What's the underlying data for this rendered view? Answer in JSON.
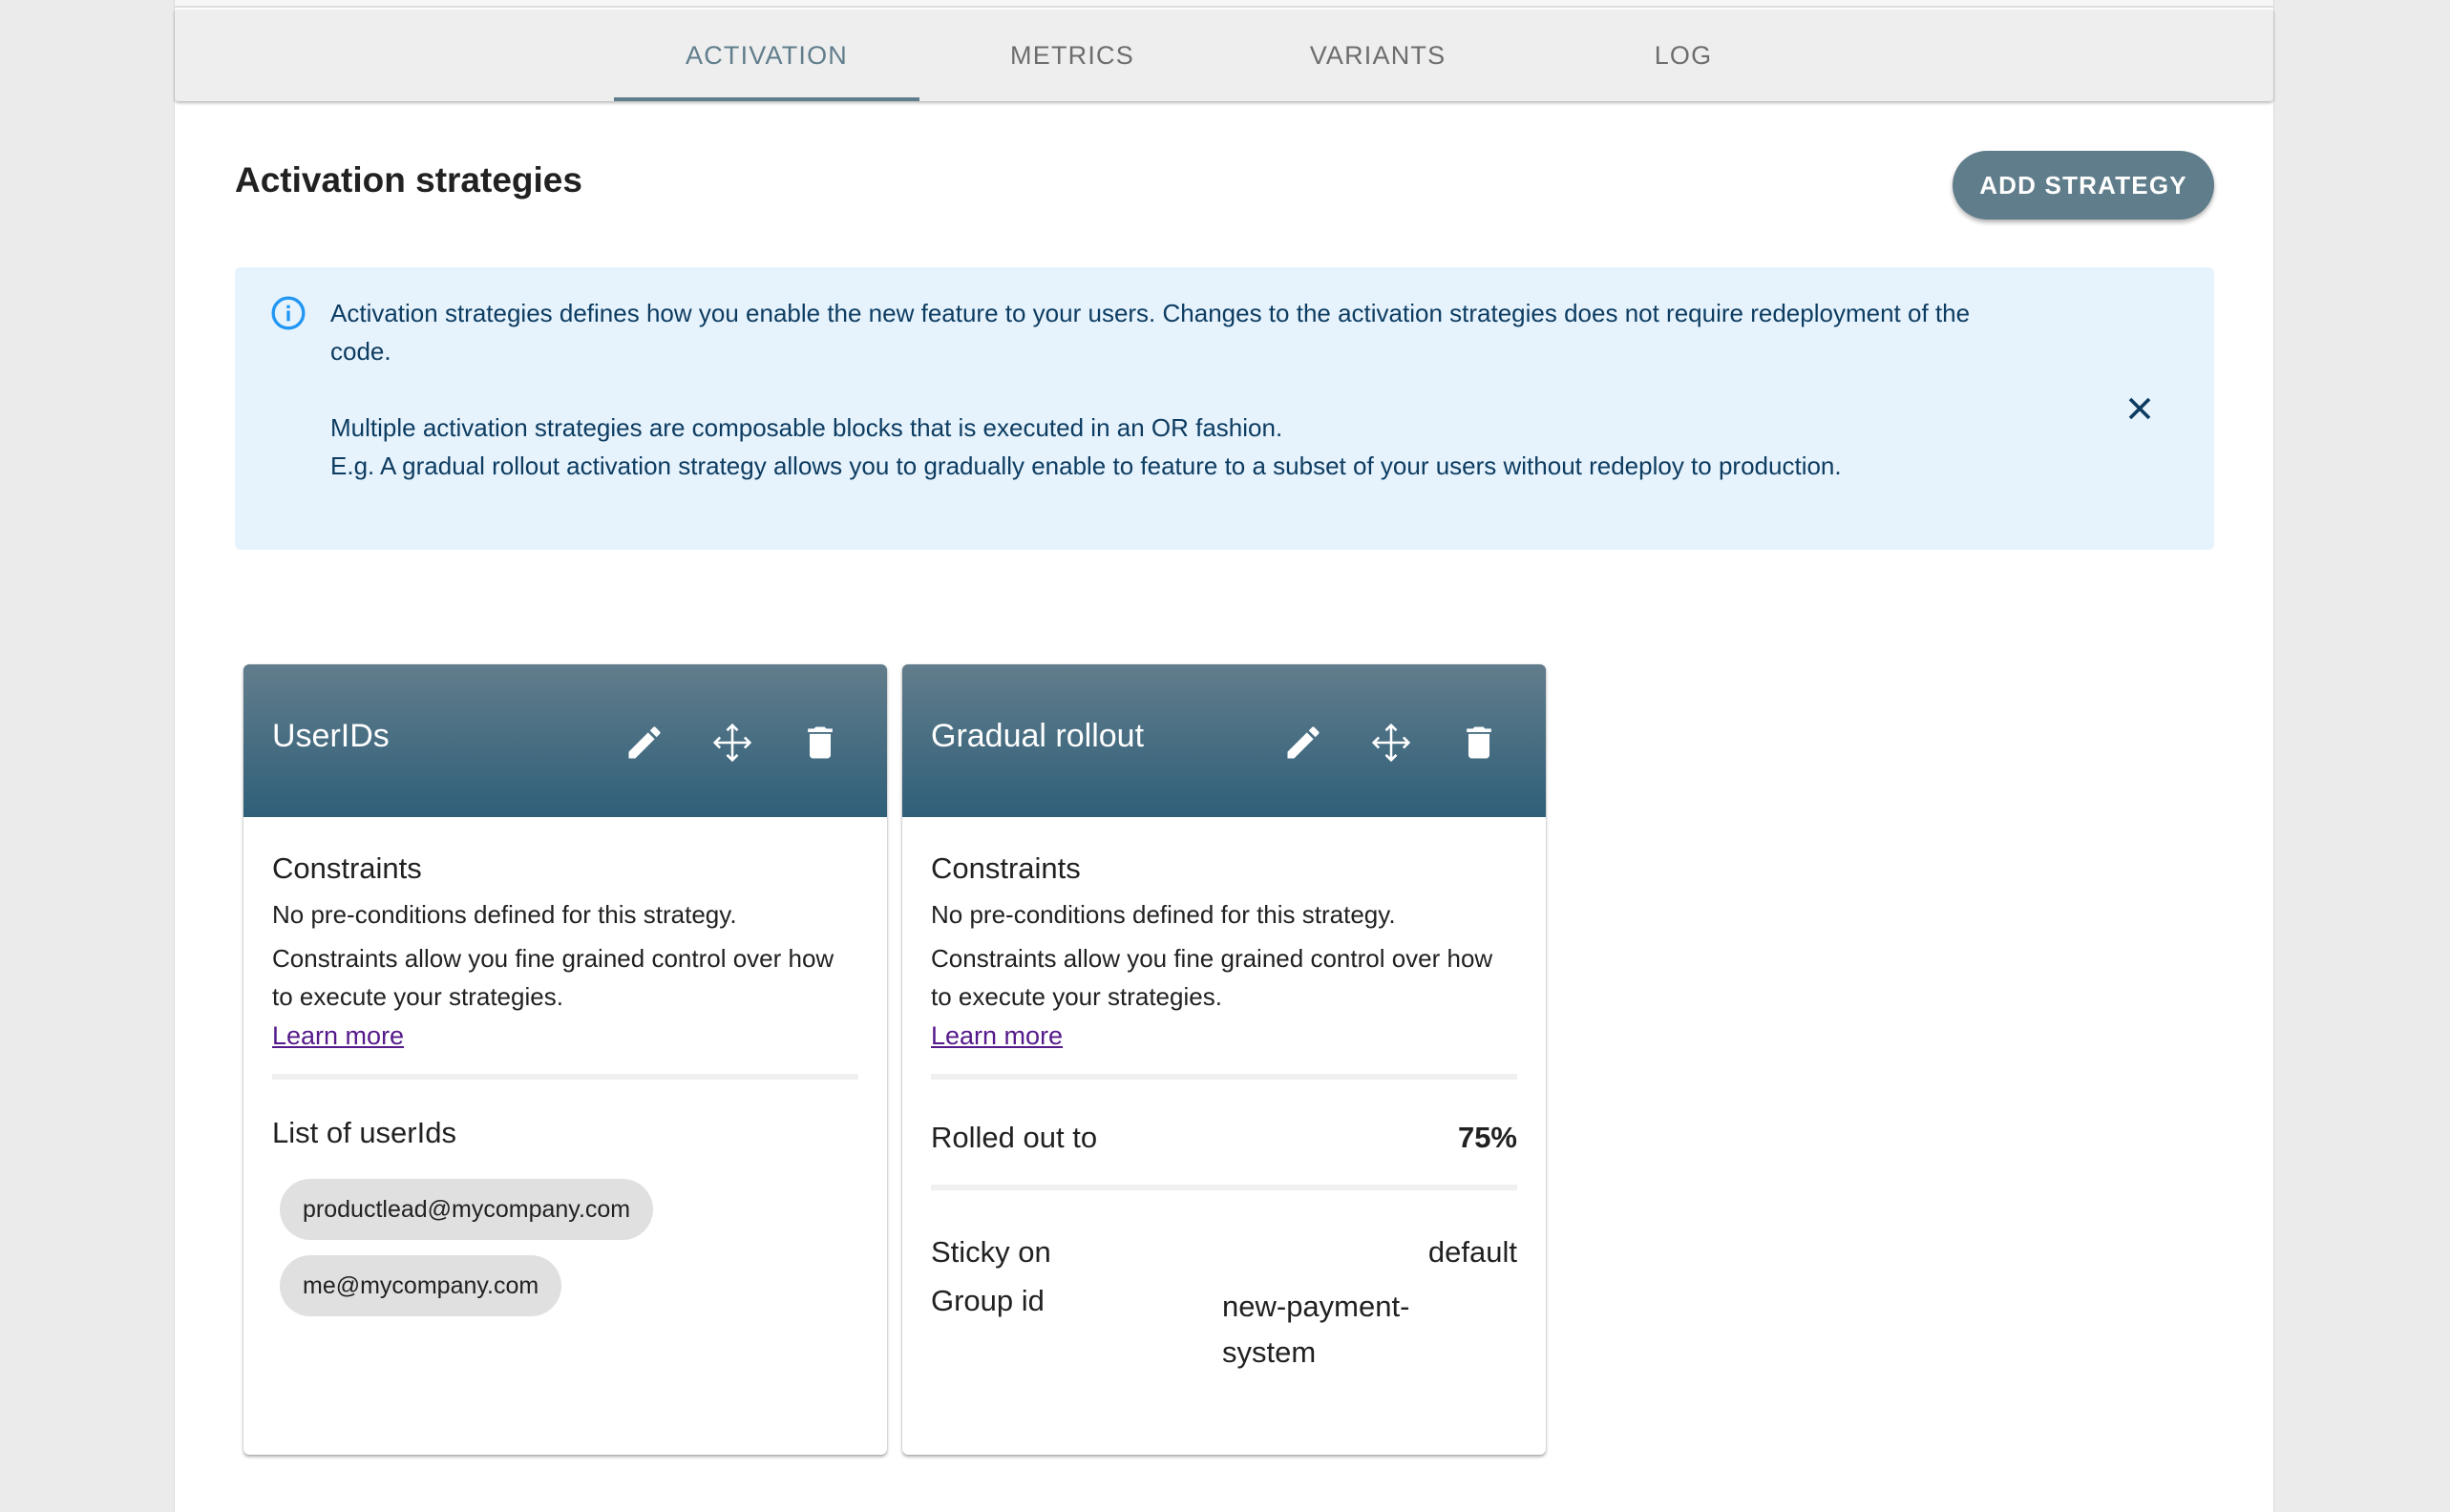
{
  "tabs": [
    {
      "label": "ACTIVATION",
      "active": true
    },
    {
      "label": "METRICS",
      "active": false
    },
    {
      "label": "VARIANTS",
      "active": false
    },
    {
      "label": "LOG",
      "active": false
    }
  ],
  "section": {
    "title": "Activation strategies",
    "add_button": "ADD STRATEGY"
  },
  "info": {
    "icon": "info-icon",
    "paragraph1": "Activation strategies defines how you enable the new feature to your users. Changes to the activation strategies does not require redeployment of the code.",
    "paragraph2": "Multiple activation strategies are composable blocks that is executed in an OR fashion.",
    "paragraph3": "E.g. A gradual rollout activation strategy allows you to gradually enable to feature to a subset of your users without redeploy to production.",
    "close_icon": "close-icon"
  },
  "strategies": [
    {
      "title": "UserIDs",
      "constraints_heading": "Constraints",
      "constraints_none": "No pre-conditions defined for this strategy.",
      "constraints_help": "Constraints allow you fine grained control over how to execute your strategies.",
      "learn_more": "Learn more",
      "list_title": "List of userIds",
      "user_ids": [
        "productlead@mycompany.com",
        "me@mycompany.com"
      ]
    },
    {
      "title": "Gradual rollout",
      "constraints_heading": "Constraints",
      "constraints_none": "No pre-conditions defined for this strategy.",
      "constraints_help": "Constraints allow you fine grained control over how to execute your strategies.",
      "learn_more": "Learn more",
      "rollout_label": "Rolled out to",
      "rollout_value": "75%",
      "sticky_label": "Sticky on",
      "sticky_value": "default",
      "group_label": "Group id",
      "group_value": "new-payment-system"
    }
  ],
  "colors": {
    "accent": "#607d8b",
    "header_gradient_top": "#627d8c",
    "header_gradient_bottom": "#2f5f79",
    "info_bg": "#e6f3fd",
    "info_text": "#0d3c61",
    "info_icon": "#2196f3",
    "link": "#551a8b",
    "chip_bg": "#e0e0e0"
  }
}
